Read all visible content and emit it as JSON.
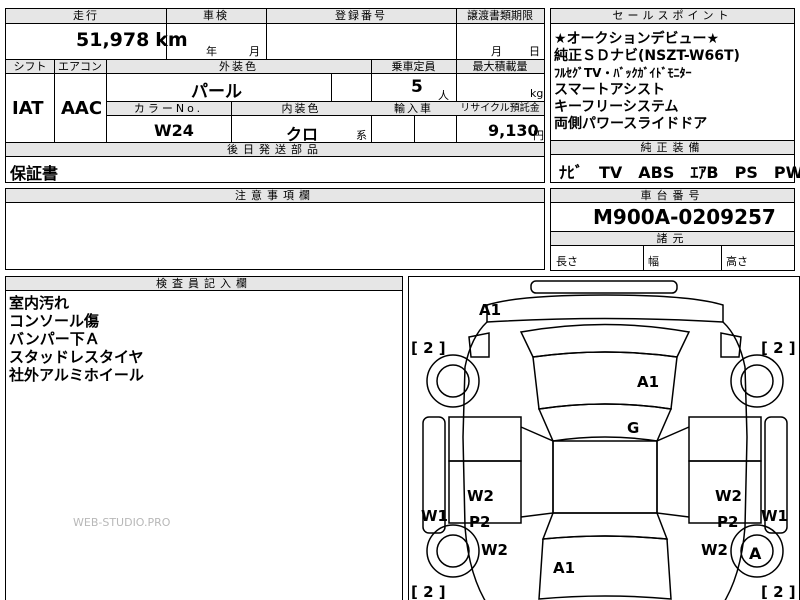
{
  "spec": {
    "h_mileage": "走行",
    "h_inspection": "車検",
    "h_reg_no": "登録番号",
    "h_transfer_deadline": "譲渡書類期限",
    "mileage": "51,978",
    "mileage_unit": "km",
    "insp_year": "年",
    "insp_month": "月",
    "transfer_month": "月",
    "transfer_day": "日",
    "h_shift": "シフト",
    "h_aircon": "エアコン",
    "h_exterior": "外装色",
    "h_capacity": "乗車定員",
    "h_max_load": "最大積載量",
    "shift": "IAT",
    "aircon": "AAC",
    "exterior_color": "パール",
    "capacity": "5",
    "capacity_unit": "人",
    "load_unit": "kg",
    "h_color_no": "カラーNo.",
    "h_interior": "内装色",
    "h_import": "輸入車",
    "h_recycle": "リサイクル預託金",
    "color_no": "W24",
    "interior_color": "クロ",
    "interior_suffix": "系",
    "recycle_fee": "9,130",
    "recycle_unit": "円"
  },
  "sales_points": {
    "header": "セールスポイント",
    "items": [
      "★オークションデビュー★",
      "純正ＳＤナビ(NSZT-W66T)",
      "ﾌﾙｾｸﾞTV・ﾊﾞｯｸｶﾞｲﾄﾞﾓﾆﾀｰ",
      "スマートアシスト",
      "キーフリーシステム",
      "両側パワースライドドア"
    ]
  },
  "equipment": {
    "header": "純正装備",
    "text": "ﾅﾋﾞ　TV　ABS　ｴｱB　PS　PW"
  },
  "later_parts": {
    "header": "後日発送部品",
    "text": "保証書"
  },
  "notes": {
    "header": "注意事項欄"
  },
  "chassis": {
    "header": "車台番号",
    "number": "M900A-0209257"
  },
  "dimensions": {
    "header": "諸元",
    "length": "長さ",
    "width": "幅",
    "height": "高さ"
  },
  "inspector": {
    "header": "検査員記入欄",
    "lines": [
      "室内汚れ",
      "コンソール傷",
      "バンパー下Ａ",
      "スタッドレスタイヤ",
      "社外アルミホイール"
    ]
  },
  "diagram": {
    "marks": {
      "a1_front": "A1",
      "a1_hood": "A1",
      "g_roof": "G",
      "a1_rear": "A1",
      "w2_left_door": "W2",
      "p2_left_door": "P2",
      "w2_left_rear": "W2",
      "w1_left": "W1",
      "w2_right_door": "W2",
      "p2_right_door": "P2",
      "w2_right_rear": "W2",
      "w1_right": "W1",
      "a_right_wheel": "A",
      "tire_fl": "[ 2 ]",
      "tire_fr": "[ 2 ]",
      "tire_rl": "[ 2 ]",
      "tire_rr": "[ 2 ]"
    }
  },
  "watermark": "WEB-STUDIO.PRO"
}
